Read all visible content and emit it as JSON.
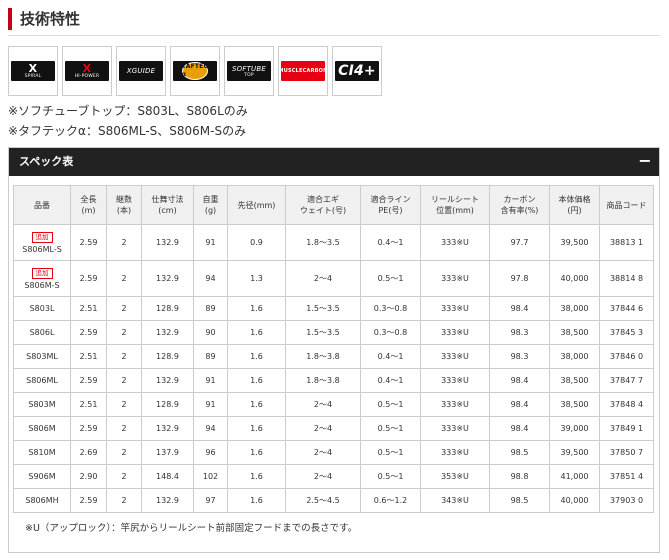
{
  "section": {
    "title": "技術特性"
  },
  "tech_logos": [
    {
      "name": "x-spiral",
      "main": "X",
      "sub": "SPIRAL"
    },
    {
      "name": "x-hipower",
      "main": "X",
      "sub": "HI-POWER"
    },
    {
      "name": "x-guide",
      "main": "XGUIDE",
      "sub": ""
    },
    {
      "name": "tafftec",
      "main": "TAFTEC α",
      "sub": ""
    },
    {
      "name": "softube-top",
      "main": "SOFTUBE",
      "sub": "TOP"
    },
    {
      "name": "muscle-carbon",
      "main": "MUSCLECARBON",
      "sub": ""
    },
    {
      "name": "ci4plus",
      "main": "CI4+",
      "sub": ""
    }
  ],
  "notes": [
    "※ソフチューブトップ：S803L、S806Lのみ",
    "※タフテックα：S806ML-S、S806M-Sのみ"
  ],
  "spec": {
    "header": "スペック表",
    "toggle": "−",
    "columns": [
      "品番",
      "全長\n(m)",
      "継数\n(本)",
      "仕舞寸法\n(cm)",
      "自重\n(g)",
      "先径(mm)",
      "適合エギ\nウェイト(号)",
      "適合ライン\nPE(号)",
      "リールシート\n位置(mm)",
      "カーボン\n含有率(%)",
      "本体価格\n(円)",
      "商品コード"
    ],
    "rows": [
      {
        "badge": "追加",
        "model": "S806ML-S",
        "length": "2.59",
        "pieces": "2",
        "closed": "132.9",
        "weight": "91",
        "tip": "0.9",
        "egi": "1.8〜3.5",
        "line": "0.4〜1",
        "reel": "333※U",
        "carbon": "97.7",
        "price": "39,500",
        "code": "38813 1"
      },
      {
        "badge": "追加",
        "model": "S806M-S",
        "length": "2.59",
        "pieces": "2",
        "closed": "132.9",
        "weight": "94",
        "tip": "1.3",
        "egi": "2〜4",
        "line": "0.5〜1",
        "reel": "333※U",
        "carbon": "97.8",
        "price": "40,000",
        "code": "38814 8"
      },
      {
        "badge": "",
        "model": "S803L",
        "length": "2.51",
        "pieces": "2",
        "closed": "128.9",
        "weight": "89",
        "tip": "1.6",
        "egi": "1.5〜3.5",
        "line": "0.3〜0.8",
        "reel": "333※U",
        "carbon": "98.4",
        "price": "38,000",
        "code": "37844 6"
      },
      {
        "badge": "",
        "model": "S806L",
        "length": "2.59",
        "pieces": "2",
        "closed": "132.9",
        "weight": "90",
        "tip": "1.6",
        "egi": "1.5〜3.5",
        "line": "0.3〜0.8",
        "reel": "333※U",
        "carbon": "98.3",
        "price": "38,500",
        "code": "37845 3"
      },
      {
        "badge": "",
        "model": "S803ML",
        "length": "2.51",
        "pieces": "2",
        "closed": "128.9",
        "weight": "89",
        "tip": "1.6",
        "egi": "1.8〜3.8",
        "line": "0.4〜1",
        "reel": "333※U",
        "carbon": "98.3",
        "price": "38,000",
        "code": "37846 0"
      },
      {
        "badge": "",
        "model": "S806ML",
        "length": "2.59",
        "pieces": "2",
        "closed": "132.9",
        "weight": "91",
        "tip": "1.6",
        "egi": "1.8〜3.8",
        "line": "0.4〜1",
        "reel": "333※U",
        "carbon": "98.4",
        "price": "38,500",
        "code": "37847 7"
      },
      {
        "badge": "",
        "model": "S803M",
        "length": "2.51",
        "pieces": "2",
        "closed": "128.9",
        "weight": "91",
        "tip": "1.6",
        "egi": "2〜4",
        "line": "0.5〜1",
        "reel": "333※U",
        "carbon": "98.4",
        "price": "38,500",
        "code": "37848 4"
      },
      {
        "badge": "",
        "model": "S806M",
        "length": "2.59",
        "pieces": "2",
        "closed": "132.9",
        "weight": "94",
        "tip": "1.6",
        "egi": "2〜4",
        "line": "0.5〜1",
        "reel": "333※U",
        "carbon": "98.4",
        "price": "39,000",
        "code": "37849 1"
      },
      {
        "badge": "",
        "model": "S810M",
        "length": "2.69",
        "pieces": "2",
        "closed": "137.9",
        "weight": "96",
        "tip": "1.6",
        "egi": "2〜4",
        "line": "0.5〜1",
        "reel": "333※U",
        "carbon": "98.5",
        "price": "39,500",
        "code": "37850 7"
      },
      {
        "badge": "",
        "model": "S906M",
        "length": "2.90",
        "pieces": "2",
        "closed": "148.4",
        "weight": "102",
        "tip": "1.6",
        "egi": "2〜4",
        "line": "0.5〜1",
        "reel": "353※U",
        "carbon": "98.8",
        "price": "41,000",
        "code": "37851 4"
      },
      {
        "badge": "",
        "model": "S806MH",
        "length": "2.59",
        "pieces": "2",
        "closed": "132.9",
        "weight": "97",
        "tip": "1.6",
        "egi": "2.5〜4.5",
        "line": "0.6〜1.2",
        "reel": "343※U",
        "carbon": "98.5",
        "price": "40,000",
        "code": "37903 0"
      }
    ],
    "footnote": "※U（アップロック）：竿尻からリールシート前部固定フードまでの長さです。"
  }
}
